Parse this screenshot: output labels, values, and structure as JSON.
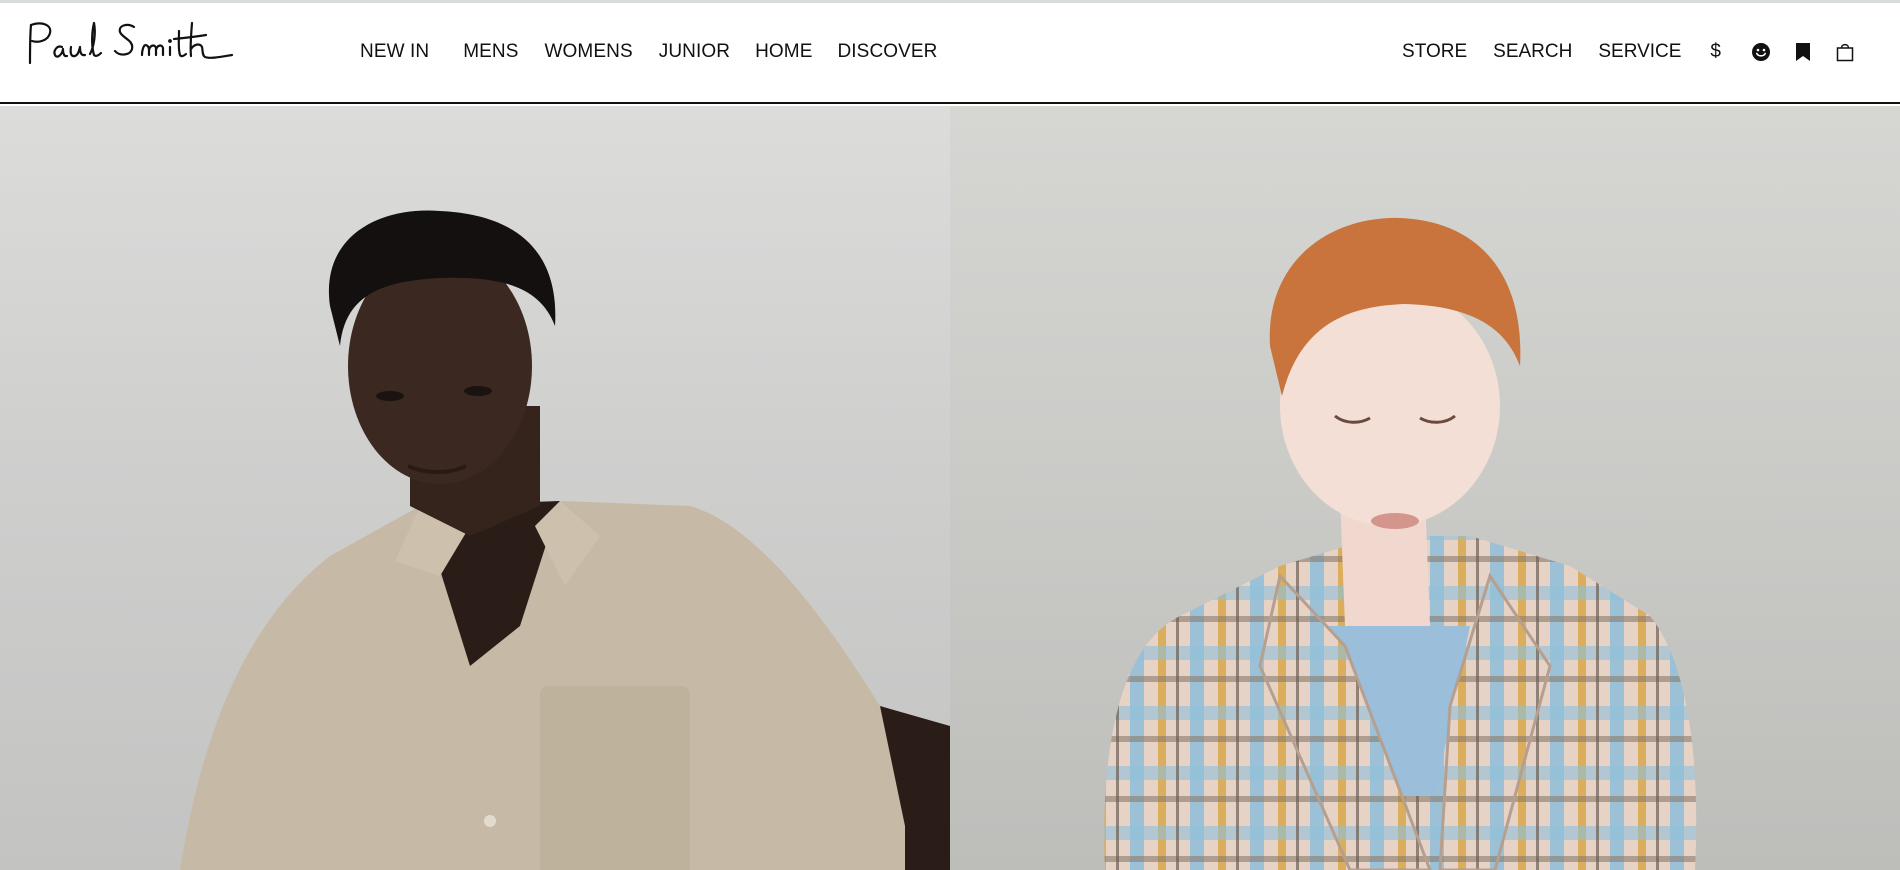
{
  "brand": {
    "name": "Paul Smith"
  },
  "main_nav": {
    "new_in": "NEW IN",
    "mens": "MENS",
    "womens": "WOMENS",
    "junior": "JUNIOR",
    "home": "HOME",
    "discover": "DISCOVER"
  },
  "utility_nav": {
    "store": "STORE",
    "search": "SEARCH",
    "service": "SERVICE",
    "currency": "$",
    "icons": [
      "account-icon",
      "wishlist-icon",
      "bag-icon"
    ]
  },
  "hero": {
    "panels": [
      {
        "subject": "mens-model-beige-shirt"
      },
      {
        "subject": "womens-model-check-blazer"
      }
    ]
  },
  "colors": {
    "text": "#111111",
    "header_bg": "#ffffff",
    "header_rule": "#111111",
    "top_rule": "#d9ddd9",
    "hero_left_bg": "#d2d2d1",
    "hero_right_bg": "#cbcbc8"
  }
}
